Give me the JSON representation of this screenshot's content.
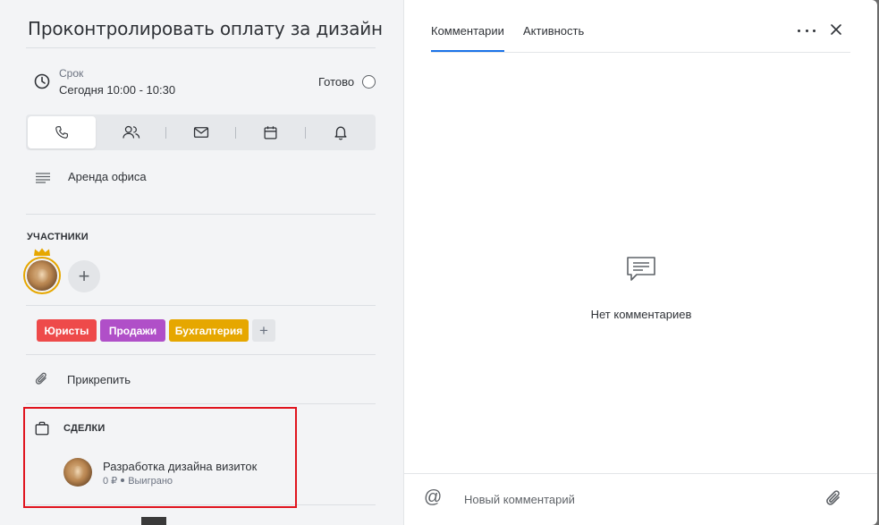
{
  "task": {
    "title": "Проконтролировать оплату за дизайн",
    "due_label": "Срок",
    "due_value": "Сегодня 10:00 - 10:30",
    "done_label": "Готово",
    "done_checked": false
  },
  "activity_types": [
    {
      "name": "call",
      "icon": "phone-icon",
      "active": true
    },
    {
      "name": "meeting",
      "icon": "people-icon",
      "active": false
    },
    {
      "name": "email",
      "icon": "mail-icon",
      "active": false
    },
    {
      "name": "event",
      "icon": "calendar-icon",
      "active": false
    },
    {
      "name": "reminder",
      "icon": "bell-icon",
      "active": false
    }
  ],
  "description": "Аренда офиса",
  "participants": {
    "label": "УЧАСТНИКИ",
    "owner_icon": "crown-icon"
  },
  "tags": [
    {
      "label": "Юристы",
      "color": "#ee4a4a"
    },
    {
      "label": "Продажи",
      "color": "#b04fc8"
    },
    {
      "label": "Бухгалтерия",
      "color": "#e6a700"
    }
  ],
  "attach_label": "Прикрепить",
  "deals": {
    "label": "СДЕЛКИ",
    "items": [
      {
        "name": "Разработка дизайна визиток",
        "amount": "0 ₽",
        "status": "Выиграно"
      }
    ]
  },
  "right": {
    "tabs": [
      "Комментарии",
      "Активность"
    ],
    "active_tab": "Комментарии",
    "empty_text": "Нет комментариев",
    "composer_placeholder": "Новый комментарий"
  },
  "colors": {
    "accent": "#1a73e8",
    "highlight_border": "#e0141e",
    "owner_ring": "#e6a700"
  }
}
